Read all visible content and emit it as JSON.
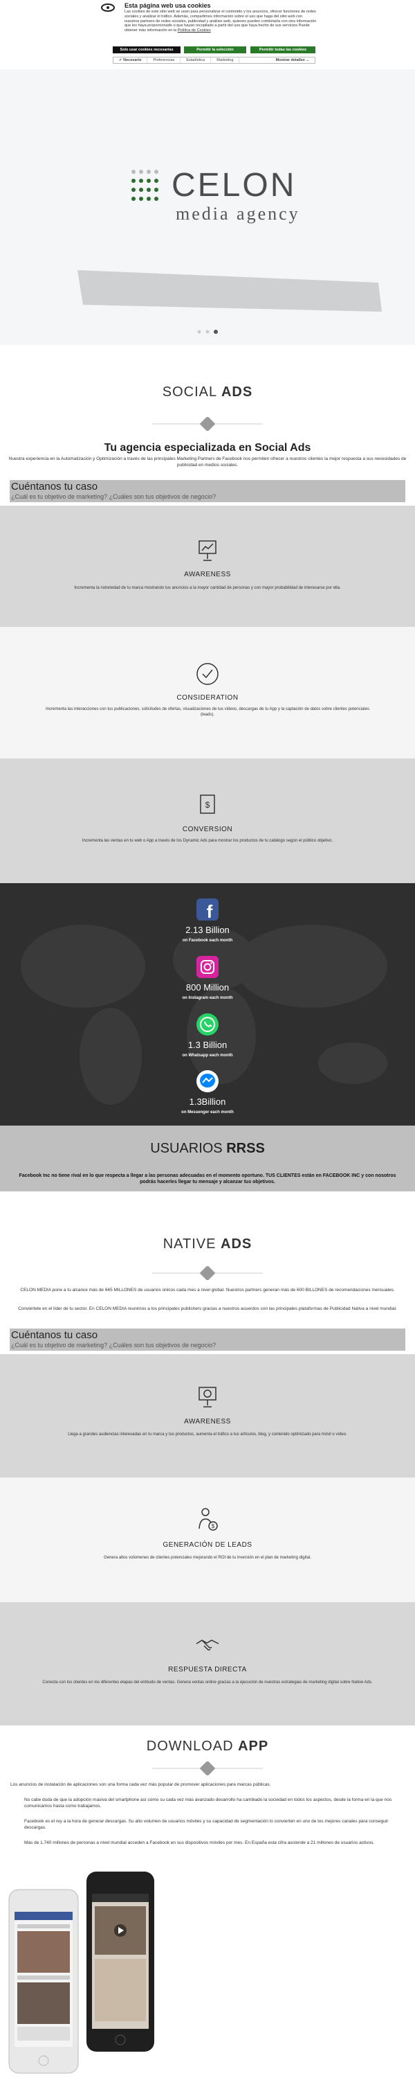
{
  "cookie": {
    "title": "Esta página web usa cookies",
    "text": "Las cookies de este sitio web se usan para personalizar el contenido y los anuncios, ofrecer funciones de redes sociales y analizar el tráfico. Además, compartimos información sobre el uso que haga del sitio web con nuestros partners de redes sociales, publicidad y análisis web, quienes pueden combinarla con otra información que les haya proporcionado o que hayan recopilado a partir del uso que haya hecho de sus servicios Puede obtener más información en la",
    "policy_link": "Política de Cookies",
    "btn_necessary": "Solo usar cookies necesarias",
    "btn_selection": "Permitir la selección",
    "btn_all": "Permitir todas las cookies",
    "checks": [
      "Necesario",
      "Preferencias",
      "Estadística",
      "Marketing"
    ],
    "details": "Mostrar detalles ⌄",
    "colors": {
      "green": "#2a7a2a",
      "dark": "#111111"
    }
  },
  "hero": {
    "brand": "CELON",
    "tagline": "media agency"
  },
  "social": {
    "title_light": "SOCIAL ",
    "title_bold": "ADS",
    "subhead": "Tu agencia especializada en Social Ads",
    "intro": "Nuestra experiencia en la Automatización y Optimización a través de las principales Marketing Partners de Facebook nos permiten ofrecer a nuestros clientes la mejor respuesta a sus necesidades de publicidad en medios sociales.",
    "case_title": "Cuéntanos tu caso",
    "case_q": "¿Cuál es tu objetivo de marketing? ¿Cuáles son tus objetivos de negocio?",
    "bands": [
      {
        "icon": "presentation-icon",
        "title": "AWARENESS",
        "desc": "Incrementa la notoriedad de tu marca mostrando tus anuncios a la mayor cantidad de personas y con mayor probabilidad de interesarse por ella."
      },
      {
        "icon": "check-circle-icon",
        "title": "CONSIDERATION",
        "desc": "Incrementa las interacciones con tus publicaciones, solicitudes de ofertas, visualizaciones de tus vídeos, descargas de tu App y la captación de datos sobre clientes potenciales (leads)."
      },
      {
        "icon": "dollar-card-icon",
        "title": "CONVERSION",
        "desc": "Incrementa las ventas en tu web o App a través de los Dynamic Ads para mostrar los productos de tu catálogo según el público objetivo."
      }
    ]
  },
  "stats": [
    {
      "icon": "facebook-icon",
      "num": "2.13 Billion",
      "label": "on Facebook each month"
    },
    {
      "icon": "instagram-icon",
      "num": "800 Million",
      "label": "on Instagram each month"
    },
    {
      "icon": "whatsapp-icon",
      "num": "1.3 Billion",
      "label": "on Whatsapp each month"
    },
    {
      "icon": "messenger-icon",
      "num": "1.3Billion",
      "label": "on Messenger each month"
    }
  ],
  "rrss": {
    "title_light": "USUARIOS ",
    "title_bold": "RRSS",
    "text_a": "Facebook Inc no tiene rival en lo que respecta a llegar a las personas adecuadas en el momento oportuno. ",
    "text_b": "TUS CLIENTES",
    "text_c": " están en FACEBOOK INC y con nosotros podrás hacerles llegar tu mensaje y alcanzar tus objetivos."
  },
  "native": {
    "title_light": "NATIVE ",
    "title_bold": "ADS",
    "p1": "CELON MEDIA pone a tu alcance más de 665 MILLONES de usuarios únicos cada mes a nivel global. Nuestros partners generan más de 600 BILLONES de recomendaciones mensuales.",
    "p2": "Conviértete en el líder de tu sector. En CELON MEDIA reunimos a los principales publishers gracias a nuestros acuerdos con las principales plataformas de Publicidad Nativa a nivel mundial.",
    "case_title": "Cuéntanos tu caso",
    "case_q": "¿Cuál es tu objetivo de marketing? ¿Cuáles son tus objetivos de negocio?",
    "bands": [
      {
        "icon": "presentation-icon",
        "title": "AWARENESS",
        "desc": "Llega a grandes audiencias interesadas en tu marca y tus productos, aumenta el tráfico a tus artículos, blog, y contenido optimizado para móvil o vídeo."
      },
      {
        "icon": "person-dollar-icon",
        "title": "GENERACIÓN DE LEADS",
        "desc": "Genera altos volúmenes de clientes potenciales mejorando el ROI de tu inversión en el plan de marketing digital."
      },
      {
        "icon": "handshake-icon",
        "title": "RESPUESTA DIRECTA",
        "desc": "Conecta con los clientes en los diferentes etapas del embudo de ventas. Genera ventas online gracias a la ejecución de nuestras estrategias de marketing digital sobre Native Ads."
      }
    ]
  },
  "download": {
    "title_light": "DOWNLOAD ",
    "title_bold": "APP",
    "p1": "Los anuncios de instalación de aplicaciones son una forma cada vez más popular de promover aplicaciones para marcas públicas.",
    "p2": "No cabe duda de que la adopción masiva del smartphone así como su cada vez más avanzado desarrollo ha cambiado la sociedad en todos los aspectos, desde la forma en la que nos comunicamos hasta como trabajamos.",
    "p3": "Facebook es el rey a la hora de generar descargas. Su alto volumen de usuarios móviles y su capacidad de segmentación lo convierten en uno de los mejores canales para conseguir descargas.",
    "p4": "Más de 1.740 millones de personas a nivel mundial acceden a Facebook en sus dispositivos móviles por mes. En España esta cifra asciende a 21 millones de usuarios activos."
  }
}
